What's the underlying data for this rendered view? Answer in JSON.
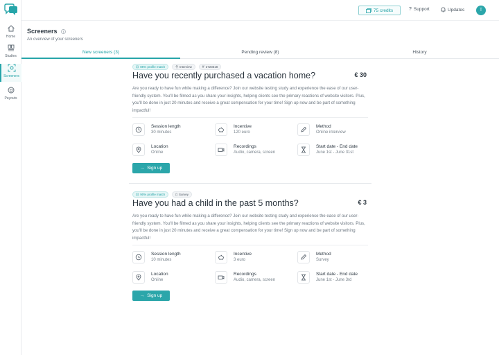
{
  "sidebar": {
    "items": [
      {
        "label": "Home",
        "icon": "home-icon"
      },
      {
        "label": "Studies",
        "icon": "studies-icon"
      },
      {
        "label": "Screeners",
        "icon": "screeners-icon",
        "active": true
      },
      {
        "label": "Payouts",
        "icon": "payouts-icon"
      }
    ]
  },
  "topbar": {
    "credits": "75 credits",
    "support": "Support",
    "updates": "Updates",
    "avatar_initial": "T"
  },
  "header": {
    "title": "Screeners",
    "subtitle": "An overview of your screeners"
  },
  "tabs": [
    {
      "label": "New screeners (3)",
      "active": true
    },
    {
      "label": "Pending review (8)",
      "active": false
    },
    {
      "label": "History",
      "active": false
    }
  ],
  "cards": [
    {
      "badges": {
        "match": "85% profile match",
        "type": "Interview",
        "id": "2723618"
      },
      "title": "Have you recently purchased a vacation home?",
      "price": "€ 30",
      "description": "Are you ready to have fun while making a difference? Join our website testing study and experience the ease of our user-friendly system. You'll be filmed as you share your insights, helping clients see the primary reactions of website visitors. Plus, you'll be done in just 20 minutes and receive a great compensation for your time! Sign up now and be part of something impactful!",
      "session_label": "Session length",
      "session_value": "30 minutes",
      "incentive_label": "Incentive",
      "incentive_value": "120 euro",
      "method_label": "Method",
      "method_value": "Online interview",
      "location_label": "Location",
      "location_value": "Online",
      "recordings_label": "Recordings",
      "recordings_value": "Audio, camera, screen",
      "dates_label": "Start date - End date",
      "dates_value": "June 1st - June 31st",
      "signup_label": "Sign up"
    },
    {
      "badges": {
        "match": "90% profile match",
        "type": "Survey"
      },
      "title": "Have you had a child in the past 5 months?",
      "price": "€ 3",
      "description": "Are you ready to have fun while making a difference? Join our website testing study and experience the ease of our user-friendly system. You'll be filmed as you share your insights, helping clients see the primary reactions of website visitors. Plus, you'll be done in just 20 minutes and receive a great compensation for your time! Sign up now and be part of something impactful!",
      "session_label": "Session length",
      "session_value": "10 minutes",
      "incentive_label": "Incentive",
      "incentive_value": "3 euro",
      "method_label": "Method",
      "method_value": "Survey",
      "location_label": "Location",
      "location_value": "Online",
      "recordings_label": "Recordings",
      "recordings_value": "Audio, camera, screen",
      "dates_label": "Start date - End date",
      "dates_value": "June 1st - June 3rd",
      "signup_label": "Sign up"
    }
  ],
  "colors": {
    "accent": "#2ba6aa",
    "border": "#e6e9ec",
    "text": "#2f3a44"
  }
}
